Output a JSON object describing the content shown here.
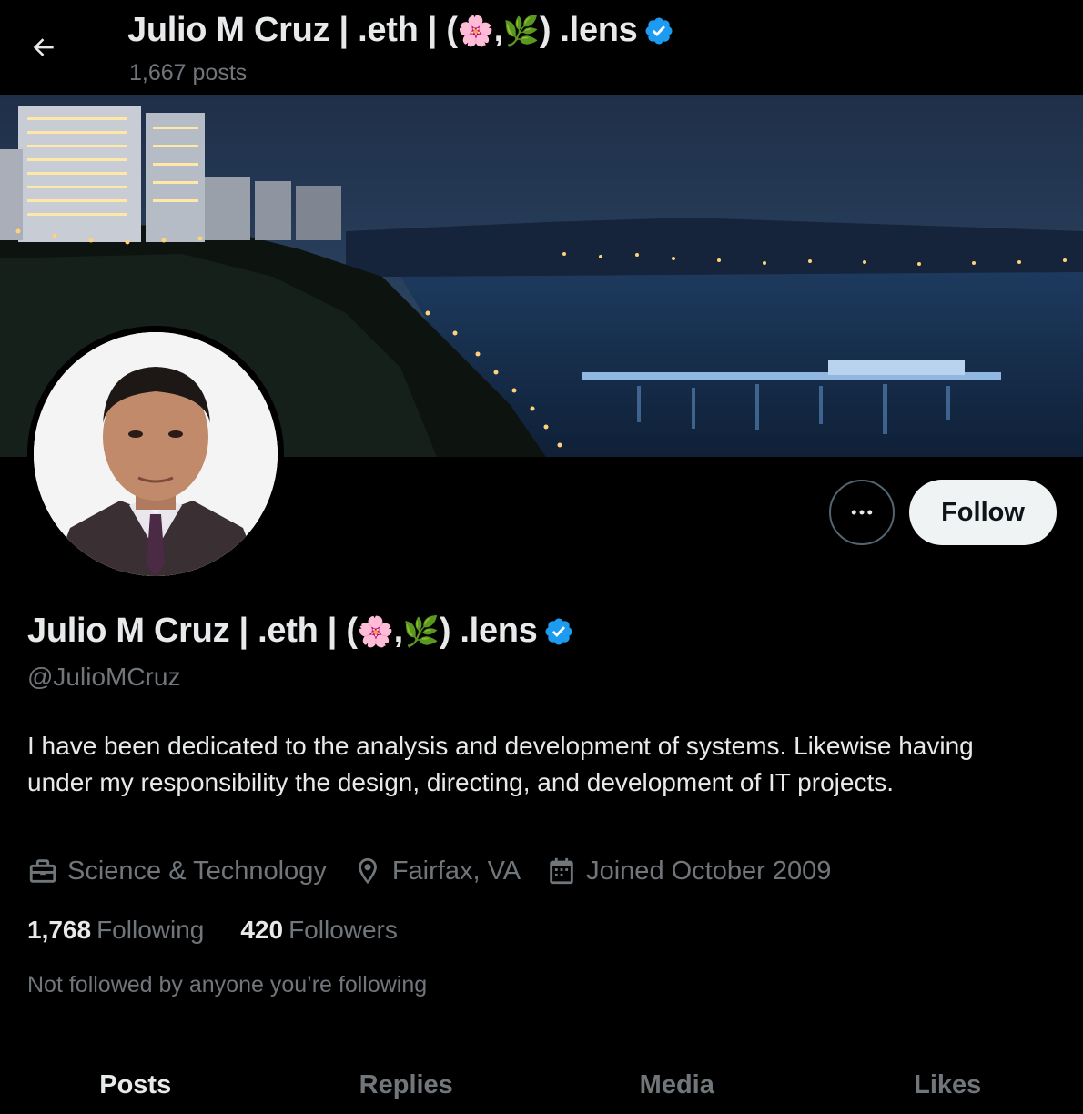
{
  "header": {
    "back_icon": "arrow-left-icon",
    "name_prefix": "Julio M Cruz | .eth | (",
    "emoji_flower": "🌸",
    "name_sep": ", ",
    "emoji_herb": "🌿",
    "name_suffix": ") .lens",
    "posts_count": "1,667 posts"
  },
  "profile": {
    "name_prefix": "Julio M Cruz | .eth | (",
    "emoji_flower": "🌸",
    "name_sep": ", ",
    "emoji_herb": "🌿",
    "name_suffix": ") .lens",
    "handle": "@JulioMCruz",
    "bio": "I have been dedicated to the analysis and development of systems. Likewise having under my responsibility the design, directing, and development of IT projects.",
    "category": "Science & Technology",
    "location": "Fairfax, VA",
    "joined": "Joined October 2009",
    "following_count": "1,768",
    "following_label": "Following",
    "followers_count": "420",
    "followers_label": "Followers",
    "not_followed": "Not followed by anyone you’re following"
  },
  "actions": {
    "more_icon": "more-horizontal-icon",
    "follow_label": "Follow"
  },
  "tabs": [
    {
      "label": "Posts",
      "active": true
    },
    {
      "label": "Replies",
      "active": false
    },
    {
      "label": "Media",
      "active": false
    },
    {
      "label": "Likes",
      "active": false
    }
  ],
  "colors": {
    "background": "#000000",
    "text": "#e7e9ea",
    "muted": "#71767b",
    "verified": "#1d9bf0",
    "follow_bg": "#eff3f4"
  }
}
